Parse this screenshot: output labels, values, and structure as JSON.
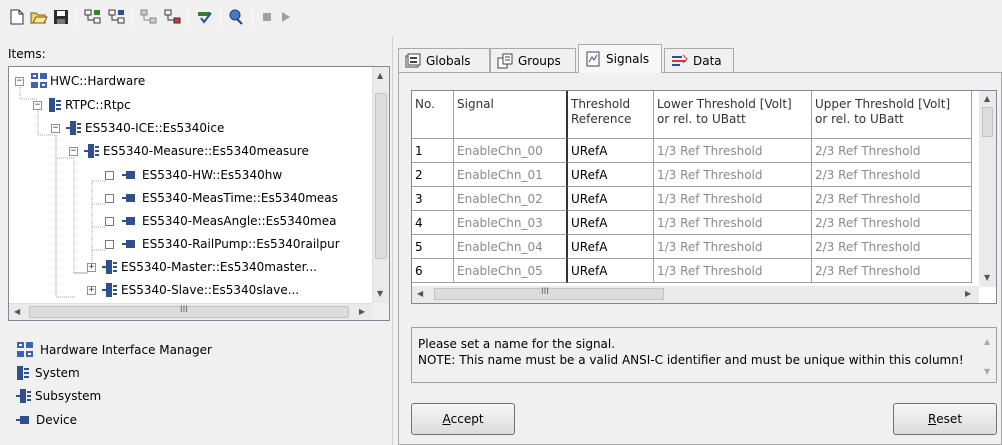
{
  "toolbar": {
    "buttons": [
      "new-file-icon",
      "open-folder-icon",
      "save-icon",
      "tree-expand-icon",
      "tree-add-icon",
      "tree-config-icon",
      "tree-edit-icon",
      "check-icon",
      "search-icon",
      "stop-icon",
      "play-icon"
    ]
  },
  "items_panel": {
    "label": "Items:",
    "tree": [
      {
        "text": "HWC::Hardware",
        "icon": "hardware-icon"
      },
      {
        "text": "RTPC::Rtpc",
        "icon": "system-icon"
      },
      {
        "text": "ES5340-ICE::Es5340ice",
        "icon": "subsystem-icon"
      },
      {
        "text": "ES5340-Measure::Es5340measure",
        "icon": "subsystem-icon"
      },
      {
        "text": "ES5340-HW::Es5340hw",
        "icon": "device-icon"
      },
      {
        "text": "ES5340-MeasTime::Es5340meas",
        "icon": "device-icon"
      },
      {
        "text": "ES5340-MeasAngle::Es5340mea",
        "icon": "device-icon"
      },
      {
        "text": "ES5340-RailPump::Es5340railpur",
        "icon": "device-icon"
      },
      {
        "text": "ES5340-Master::Es5340master...",
        "icon": "subsystem-icon"
      },
      {
        "text": "ES5340-Slave::Es5340slave...",
        "icon": "subsystem-icon"
      }
    ],
    "scroll_hint": "III"
  },
  "legend": [
    {
      "text": "Hardware Interface Manager",
      "icon": "hardware-icon"
    },
    {
      "text": "System",
      "icon": "system-icon"
    },
    {
      "text": "Subsystem",
      "icon": "subsystem-icon"
    },
    {
      "text": "Device",
      "icon": "device-icon"
    }
  ],
  "tabs": [
    {
      "label": "Globals",
      "icon": "globals-icon"
    },
    {
      "label": "Groups",
      "icon": "groups-icon"
    },
    {
      "label": "Signals",
      "icon": "signals-icon",
      "active": true
    },
    {
      "label": "Data",
      "icon": "data-icon"
    }
  ],
  "grid": {
    "headers": [
      {
        "line1": "No.",
        "line2": ""
      },
      {
        "line1": "Signal",
        "line2": ""
      },
      {
        "line1": "Threshold",
        "line2": "Reference"
      },
      {
        "line1": "Lower Threshold [Volt]",
        "line2": "or rel. to UBatt"
      },
      {
        "line1": "Upper Threshold [Volt]",
        "line2": "or rel. to UBatt"
      }
    ],
    "rows": [
      [
        "1",
        "EnableChn_00",
        "URefA",
        "1/3 Ref Threshold",
        "2/3 Ref Threshold"
      ],
      [
        "2",
        "EnableChn_01",
        "URefA",
        "1/3 Ref Threshold",
        "2/3 Ref Threshold"
      ],
      [
        "3",
        "EnableChn_02",
        "URefA",
        "1/3 Ref Threshold",
        "2/3 Ref Threshold"
      ],
      [
        "4",
        "EnableChn_03",
        "URefA",
        "1/3 Ref Threshold",
        "2/3 Ref Threshold"
      ],
      [
        "5",
        "EnableChn_04",
        "URefA",
        "1/3 Ref Threshold",
        "2/3 Ref Threshold"
      ],
      [
        "6",
        "EnableChn_05",
        "URefA",
        "1/3 Ref Threshold",
        "2/3 Ref Threshold"
      ]
    ],
    "scroll_hint": "III"
  },
  "help": {
    "line1": "Please set a name for the signal.",
    "line2": "NOTE: This name must be a valid ANSI-C identifier and must be unique within this column!"
  },
  "buttons": {
    "accept_label": "ccept",
    "accept_mnemonic": "A",
    "reset_label": "eset",
    "reset_mnemonic": "R"
  }
}
